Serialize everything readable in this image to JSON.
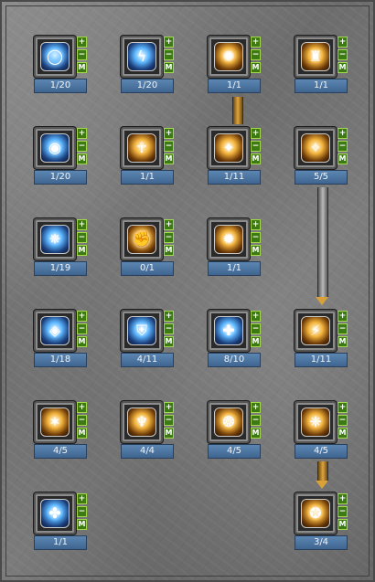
{
  "buttons": {
    "plus": "+",
    "minus": "−",
    "max": "M"
  },
  "skills": [
    {
      "level": "1/20",
      "icon": "shield-skill-icon",
      "glyph": "◯",
      "tone": "blue"
    },
    {
      "level": "1/20",
      "icon": "lightning-skill-icon",
      "glyph": "ϟ",
      "tone": "blue"
    },
    {
      "level": "1/1",
      "icon": "flame-skill-icon",
      "glyph": "✺",
      "tone": "gold"
    },
    {
      "level": "1/1",
      "icon": "boot-skill-icon",
      "glyph": "♜",
      "tone": "gold"
    },
    {
      "level": "1/20",
      "icon": "orb-skill-icon",
      "glyph": "◉",
      "tone": "blue"
    },
    {
      "level": "1/1",
      "icon": "figure-skill-icon",
      "glyph": "☥",
      "tone": "gold"
    },
    {
      "level": "1/11",
      "icon": "claw-skill-icon",
      "glyph": "✦",
      "tone": "gold"
    },
    {
      "level": "5/5",
      "icon": "rune-skill-icon",
      "glyph": "✧",
      "tone": "gold"
    },
    {
      "level": "1/19",
      "icon": "burst-skill-icon",
      "glyph": "✵",
      "tone": "blue"
    },
    {
      "level": "0/1",
      "icon": "fist-skill-icon",
      "glyph": "✊",
      "tone": "gold"
    },
    {
      "level": "1/1",
      "icon": "fireball-skill-icon",
      "glyph": "✹",
      "tone": "gold"
    },
    {
      "level": "1/18",
      "icon": "sigil-skill-icon",
      "glyph": "◈",
      "tone": "blue"
    },
    {
      "level": "4/11",
      "icon": "crest-skill-icon",
      "glyph": "⛨",
      "tone": "blue"
    },
    {
      "level": "8/10",
      "icon": "cross-shield-skill-icon",
      "glyph": "✚",
      "tone": "blue"
    },
    {
      "level": "1/11",
      "icon": "slash-skill-icon",
      "glyph": "⚡",
      "tone": "gold"
    },
    {
      "level": "4/5",
      "icon": "spirit-skill-icon",
      "glyph": "✶",
      "tone": "gold"
    },
    {
      "level": "4/4",
      "icon": "warrior-skill-icon",
      "glyph": "♆",
      "tone": "gold"
    },
    {
      "level": "4/5",
      "icon": "aura-skill-icon",
      "glyph": "❂",
      "tone": "gold"
    },
    {
      "level": "4/5",
      "icon": "totem-skill-icon",
      "glyph": "❈",
      "tone": "gold"
    },
    {
      "level": "1/1",
      "icon": "spirit-blue-skill-icon",
      "glyph": "✤",
      "tone": "blue"
    },
    {
      "level": "3/4",
      "icon": "orb-ring-skill-icon",
      "glyph": "✪",
      "tone": "gold"
    }
  ]
}
